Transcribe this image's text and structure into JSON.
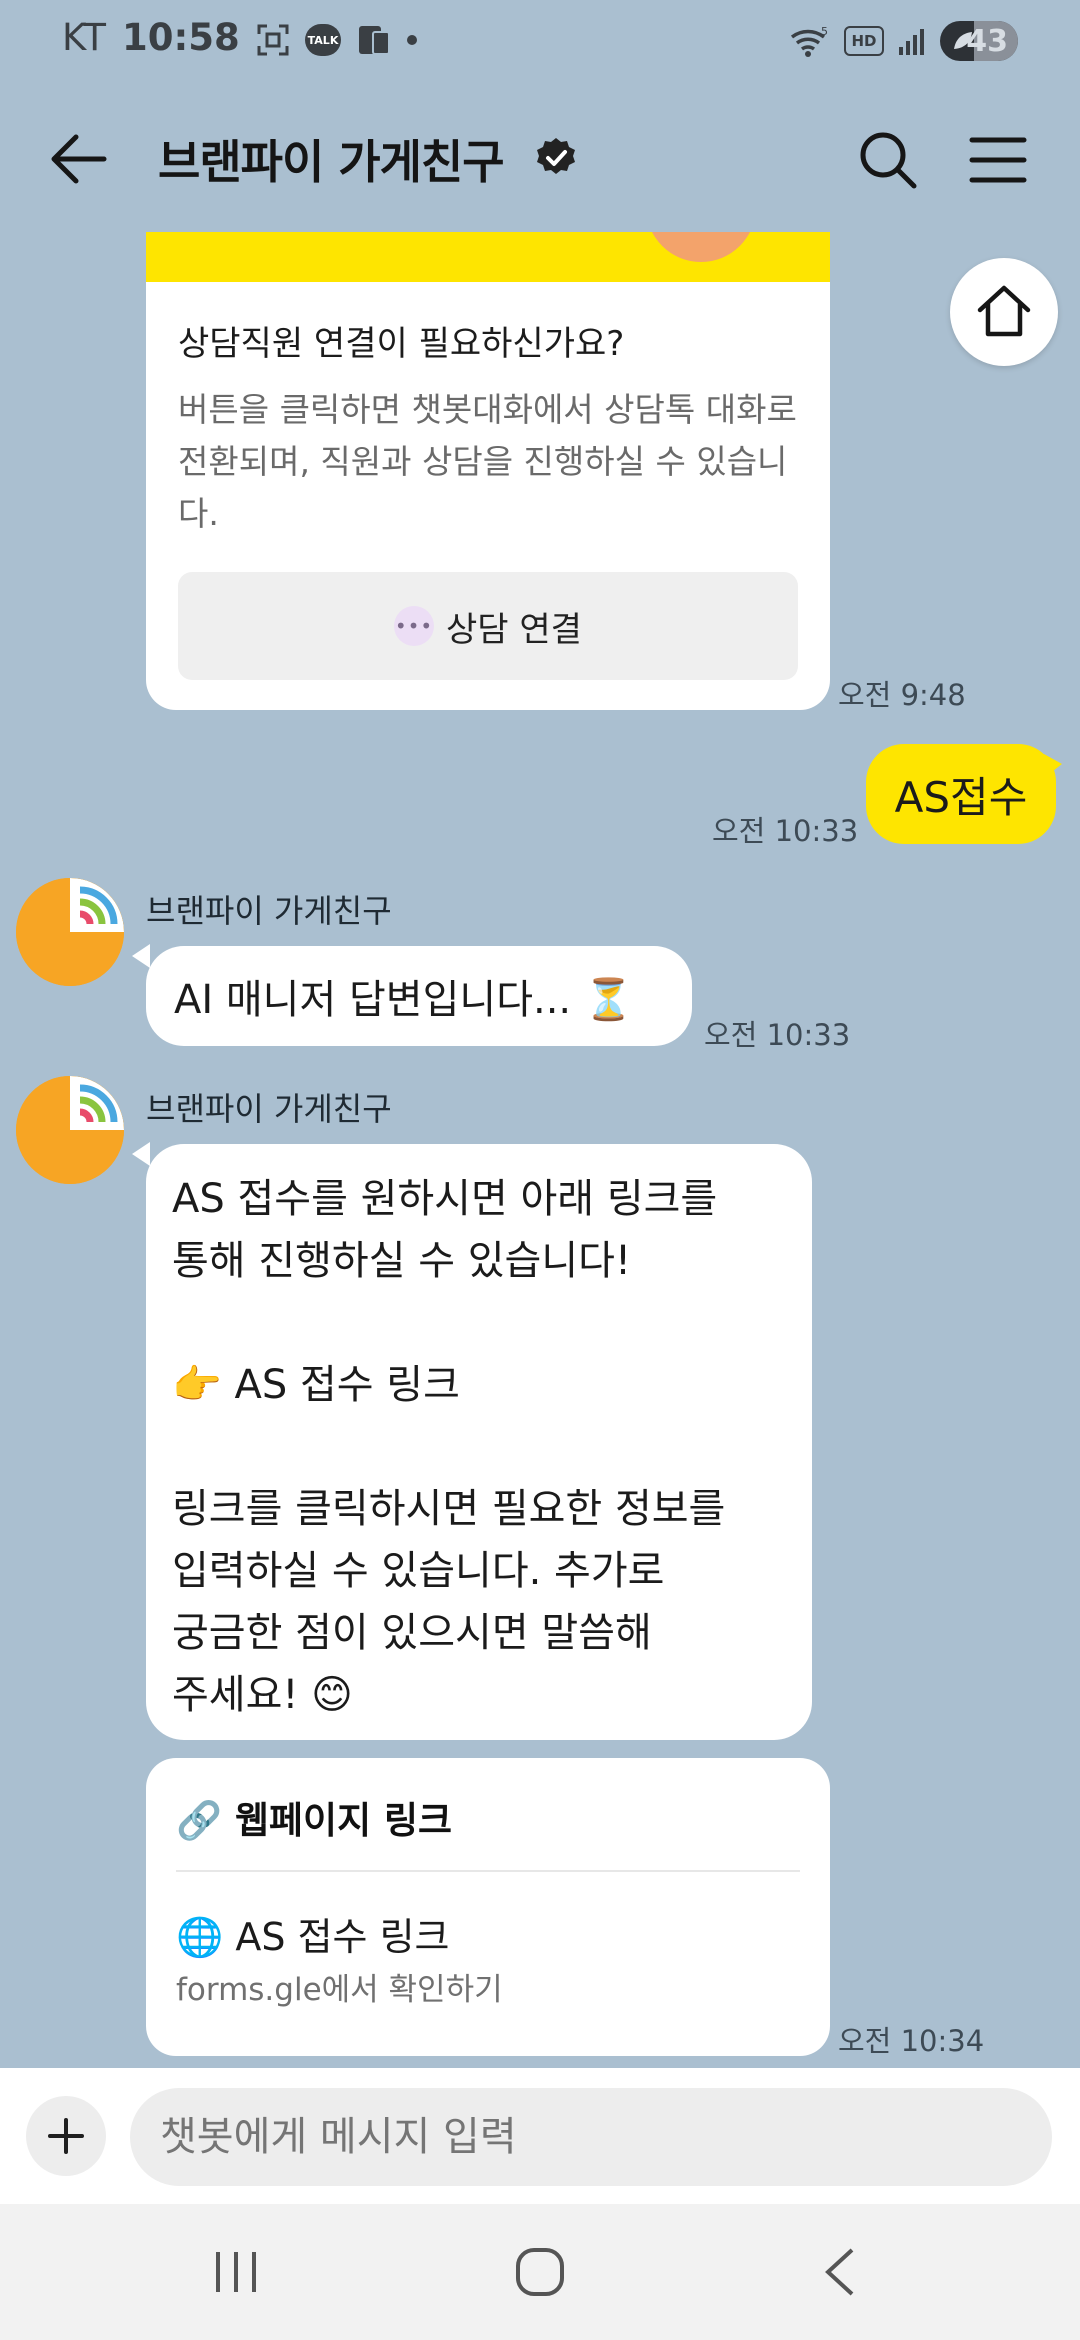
{
  "status_bar": {
    "carrier": "KT",
    "time": "10:58",
    "talk_badge": "TALK",
    "signal_label": "5",
    "hd_label": "HD",
    "battery": "43"
  },
  "header": {
    "title": "브랜파이 가게친구"
  },
  "consult_card": {
    "title": "상담직원 연결이 필요하신가요?",
    "body": "버튼을 클릭하면 챗봇대화에서 상담톡 대화로 전환되며, 직원과 상담을 진행하실 수 있습니다.",
    "button_label": "상담 연결",
    "time": "오전 9:48"
  },
  "user_message": {
    "text": "AS접수",
    "time": "오전 10:33"
  },
  "bot_message_1": {
    "sender": "브랜파이 가게친구",
    "text": "AI 매니저 답변입니다... ⏳",
    "time": "오전 10:33"
  },
  "bot_message_2": {
    "sender": "브랜파이 가게친구",
    "line1": "AS 접수를 원하시면 아래 링크를",
    "line2": "통해 진행하실 수 있습니다!",
    "line3": "👉 AS 접수 링크",
    "line4": "링크를 클릭하시면 필요한 정보를",
    "line5": "입력하실 수 있습니다. 추가로",
    "line6": "궁금한 점이 있으시면 말씀해",
    "line7": "주세요! 😊"
  },
  "link_card": {
    "title": "🔗 웹페이지 링크",
    "link_label": "🌐 AS 접수 링크",
    "sub": "forms.gle에서 확인하기",
    "time": "오전 10:34"
  },
  "composer": {
    "placeholder": "챗봇에게 메시지 입력"
  },
  "icons": {
    "back": "arrow-left-icon",
    "verified": "verified-badge-icon",
    "search": "search-icon",
    "menu": "hamburger-menu-icon",
    "home": "home-icon",
    "plus": "plus-icon",
    "nav_recents": "recent-apps-icon",
    "nav_home": "home-circle-icon",
    "nav_back": "back-chevron-icon"
  },
  "colors": {
    "chat_bg": "#aabfd0",
    "user_bubble": "#fee500",
    "avatar": "#f7a524"
  }
}
